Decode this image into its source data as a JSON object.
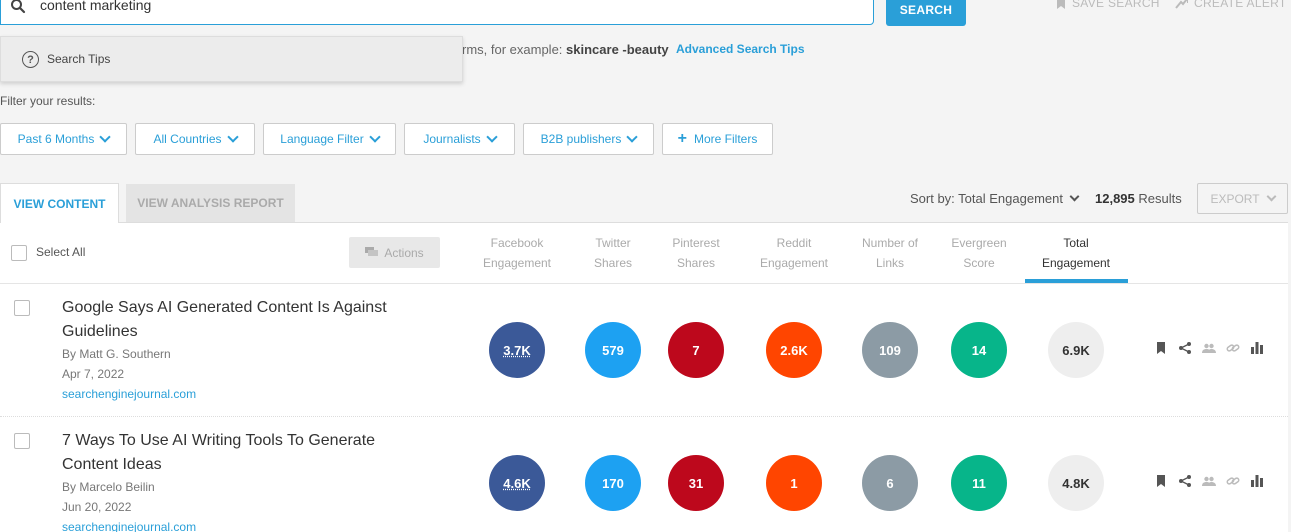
{
  "search": {
    "query": "content marketing",
    "button_label": "SEARCH",
    "save_search": "SAVE SEARCH",
    "create_alert": "CREATE ALERT",
    "hint_prefix": "rms, for example: ",
    "hint_example": "skincare -beauty",
    "advanced_tips": "Advanced Search Tips",
    "tips_label": "Search Tips"
  },
  "filters": {
    "label": "Filter your results:",
    "buttons": [
      "Past 6 Months",
      "All Countries",
      "Language Filter",
      "Journalists",
      "B2B publishers",
      "More Filters"
    ]
  },
  "tabs": {
    "view_content": "VIEW CONTENT",
    "view_analysis": "VIEW ANALYSIS REPORT"
  },
  "sort": {
    "label": "Sort by: Total Engagement",
    "results_count": "12,895",
    "results_label": " Results",
    "export": "EXPORT"
  },
  "table": {
    "select_all": "Select All",
    "actions": "Actions",
    "columns": [
      [
        "Facebook",
        "Engagement"
      ],
      [
        "Twitter",
        "Shares"
      ],
      [
        "Pinterest",
        "Shares"
      ],
      [
        "Reddit",
        "Engagement"
      ],
      [
        "Number of",
        "Links"
      ],
      [
        "Evergreen",
        "Score"
      ],
      [
        "Total",
        "Engagement"
      ]
    ]
  },
  "articles": [
    {
      "title": "Google Says AI Generated Content Is Against Guidelines",
      "author": "By  Matt G. Southern",
      "date": "Apr 7, 2022",
      "domain": "searchenginejournal.com",
      "facebook": "3.7K",
      "twitter": "579",
      "pinterest": "7",
      "reddit": "2.6K",
      "links": "109",
      "evergreen": "14",
      "total": "6.9K"
    },
    {
      "title": "7 Ways To Use AI Writing Tools To Generate Content Ideas",
      "author": "By  Marcelo Beilin",
      "date": "Jun 20, 2022",
      "domain": "searchenginejournal.com",
      "facebook": "4.6K",
      "twitter": "170",
      "pinterest": "31",
      "reddit": "1",
      "links": "6",
      "evergreen": "11",
      "total": "4.8K"
    }
  ],
  "colors": {
    "accent": "#2a9fd8",
    "facebook": "#3b5998",
    "twitter": "#1da1f2",
    "pinterest": "#bd081c",
    "reddit": "#ff4500",
    "links": "#8c9ba5",
    "evergreen": "#07b58a"
  }
}
